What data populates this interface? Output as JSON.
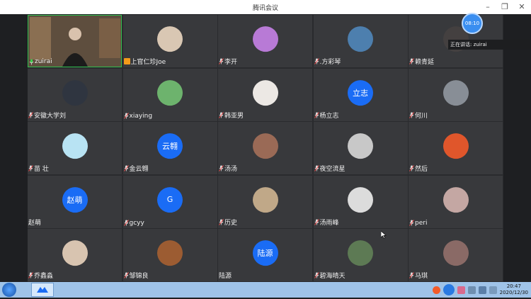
{
  "window": {
    "title": "腾讯会议"
  },
  "status": {
    "speaking_label": "正在讲话: zuirai",
    "speaker_bubble": "08:10"
  },
  "participants": [
    {
      "name": "zuirai",
      "avatar_type": "video",
      "mic": "on"
    },
    {
      "name": "上官仁珍Joe",
      "avatar_type": "photo",
      "color": "#d9c7b3",
      "mic": "host"
    },
    {
      "name": "李开",
      "avatar_type": "photo",
      "color": "#b87ad6",
      "mic": "muted"
    },
    {
      "name": ".方彩琴",
      "avatar_type": "photo",
      "color": "#4d7fae",
      "mic": "muted"
    },
    {
      "name": "赖青延",
      "avatar_type": "photo",
      "color": "#444040",
      "mic": "muted"
    },
    {
      "name": "安徽大学刘",
      "avatar_type": "photo",
      "color": "#2f3540",
      "mic": "muted"
    },
    {
      "name": "xiaying",
      "avatar_type": "photo",
      "color": "#6db36d",
      "mic": "muted"
    },
    {
      "name": "韩亚男",
      "avatar_type": "photo",
      "color": "#ece8e4",
      "mic": "muted"
    },
    {
      "name": "杨立志",
      "avatar_type": "text",
      "text": "立志",
      "mic": "muted"
    },
    {
      "name": "何川",
      "avatar_type": "photo",
      "color": "#888e96",
      "mic": "muted"
    },
    {
      "name": "苗 壮",
      "avatar_type": "photo",
      "color": "#b8e3f3",
      "mic": "muted"
    },
    {
      "name": "金云翱",
      "avatar_type": "text",
      "text": "云翱",
      "mic": "muted"
    },
    {
      "name": "汤汤",
      "avatar_type": "photo",
      "color": "#9a6a56",
      "mic": "muted"
    },
    {
      "name": "夜空流星",
      "avatar_type": "photo",
      "color": "#c8c8c8",
      "mic": "muted"
    },
    {
      "name": "然后",
      "avatar_type": "photo",
      "color": "#e0562b",
      "mic": "muted"
    },
    {
      "name": "赵萌",
      "avatar_type": "text",
      "text": "赵萌",
      "mic": "none"
    },
    {
      "name": "gcyy",
      "avatar_type": "text",
      "text": "G",
      "mic": "muted"
    },
    {
      "name": "历史",
      "avatar_type": "photo",
      "color": "#c0a888",
      "mic": "muted"
    },
    {
      "name": "汤雨峰",
      "avatar_type": "photo",
      "color": "#dcdcdc",
      "mic": "muted"
    },
    {
      "name": "peri",
      "avatar_type": "photo",
      "color": "#c4a7a3",
      "mic": "muted"
    },
    {
      "name": "乔鑫淼",
      "avatar_type": "photo",
      "color": "#d8c4b0",
      "mic": "muted"
    },
    {
      "name": "邹锦良",
      "avatar_type": "photo",
      "color": "#9c5c32",
      "mic": "muted"
    },
    {
      "name": "陆源",
      "avatar_type": "text",
      "text": "陆源",
      "mic": "none"
    },
    {
      "name": "碧海晴天",
      "avatar_type": "photo",
      "color": "#5d7a54",
      "mic": "muted"
    },
    {
      "name": "马琪",
      "avatar_type": "photo",
      "color": "#8a6a66",
      "mic": "muted"
    }
  ],
  "taskbar": {
    "time": "20:47",
    "date": "2020/12/30"
  },
  "colors": {
    "accent": "#1a6cf5",
    "background": "#1e1f22",
    "tile": "#38393c"
  }
}
